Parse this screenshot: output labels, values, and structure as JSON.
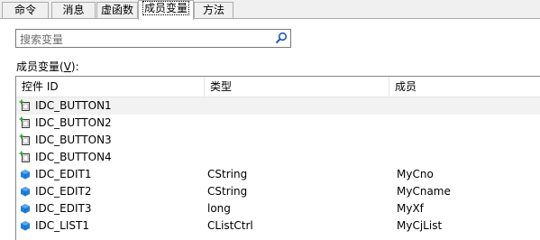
{
  "tabs": [
    {
      "label": "命令"
    },
    {
      "label": "消息"
    },
    {
      "label": "虚函数"
    },
    {
      "label": "成员变量"
    },
    {
      "label": "方法"
    }
  ],
  "search": {
    "placeholder": "搜索变量"
  },
  "members_label": {
    "text": "成员变量(",
    "mnemonic": "V",
    "suffix": "):"
  },
  "columns": {
    "control_id": "控件 ID",
    "type": "类型",
    "member": "成员"
  },
  "rows": [
    {
      "icon": "button-control-icon",
      "id": "IDC_BUTTON1",
      "type": "",
      "member": ""
    },
    {
      "icon": "button-control-icon",
      "id": "IDC_BUTTON2",
      "type": "",
      "member": ""
    },
    {
      "icon": "button-control-icon",
      "id": "IDC_BUTTON3",
      "type": "",
      "member": ""
    },
    {
      "icon": "button-control-icon",
      "id": "IDC_BUTTON4",
      "type": "",
      "member": ""
    },
    {
      "icon": "variable-icon",
      "id": "IDC_EDIT1",
      "type": "CString",
      "member": "MyCno"
    },
    {
      "icon": "variable-icon",
      "id": "IDC_EDIT2",
      "type": "CString",
      "member": "MyCname"
    },
    {
      "icon": "variable-icon",
      "id": "IDC_EDIT3",
      "type": "long",
      "member": "MyXf"
    },
    {
      "icon": "variable-icon",
      "id": "IDC_LIST1",
      "type": "CListCtrl",
      "member": "MyCjList"
    }
  ],
  "colors": {
    "variable_icon": "#1f7fd8",
    "button_icon_plus": "#2fa82f",
    "selected_row": "#f2f2f2"
  }
}
